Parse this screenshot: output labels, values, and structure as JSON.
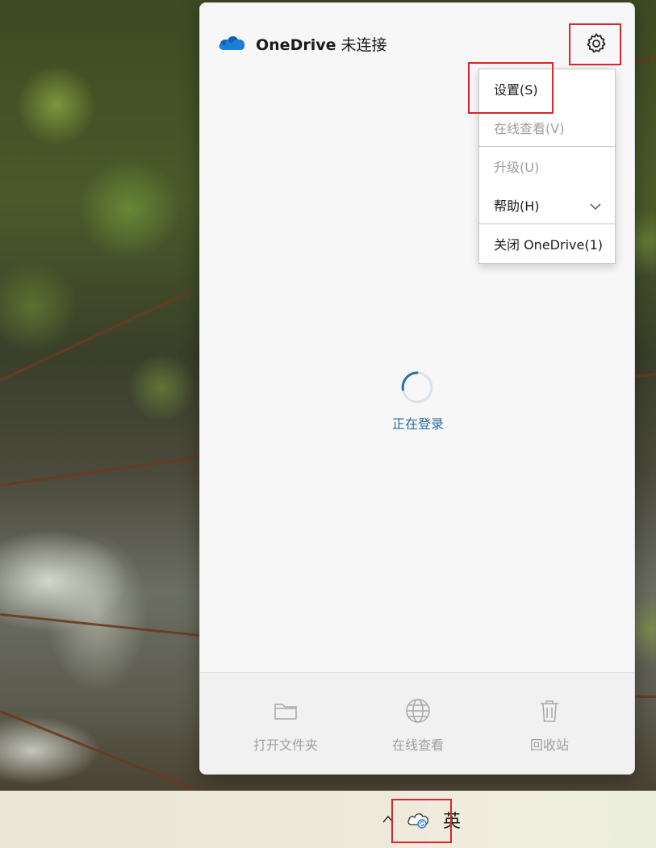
{
  "flyout": {
    "app_name": "OneDrive",
    "status": "未连接",
    "loading_text": "正在登录",
    "footer": [
      {
        "label": "打开文件夹",
        "icon": "folder-icon"
      },
      {
        "label": "在线查看",
        "icon": "globe-icon"
      },
      {
        "label": "回收站",
        "icon": "recycle-bin-icon"
      }
    ]
  },
  "menu": {
    "items": [
      {
        "label": "设置(S)",
        "enabled": true
      },
      {
        "label": "在线查看(V)",
        "enabled": false
      },
      {
        "label": "升级(U)",
        "enabled": false
      },
      {
        "label": "帮助(H)",
        "enabled": true,
        "submenu": true
      },
      {
        "label": "关闭 OneDrive(1)",
        "enabled": true
      }
    ]
  },
  "taskbar": {
    "ime_indicator": "英",
    "icons": [
      "chevron-up-icon",
      "onedrive-sync-icon"
    ]
  },
  "colors": {
    "accent": "#2a6ea8",
    "highlight": "#d9262c",
    "onedrive_blue": "#1e7bd6"
  }
}
